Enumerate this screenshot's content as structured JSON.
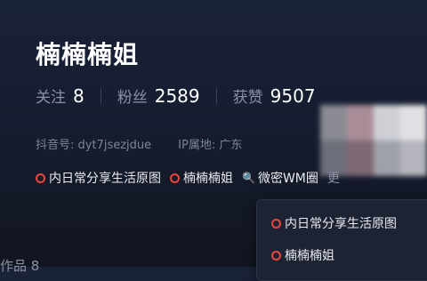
{
  "profile": {
    "name": "楠楠楠姐",
    "stats": [
      {
        "label": "关注",
        "value": "8"
      },
      {
        "label": "粉丝",
        "value": "2589"
      },
      {
        "label": "获赞",
        "value": "9507"
      }
    ],
    "douyin_id": "抖音号: dyt7jsezjdue",
    "ip": "IP属地: 广东"
  },
  "tags": [
    {
      "label": "内日常分享生活原图",
      "icon": "red-ring-icon"
    },
    {
      "label": "楠楠楠姐",
      "icon": "red-ring-icon"
    },
    {
      "label": "微密WM圈",
      "icon": "magnifier-icon"
    },
    {
      "label": "更"
    }
  ],
  "dropdown": {
    "items": [
      {
        "label": "内日常分享生活原图",
        "icon": "red-ring-icon"
      },
      {
        "label": "楠楠楠姐",
        "icon": "red-ring-icon"
      }
    ]
  },
  "partial_row": {
    "text": "作品 8"
  },
  "colors": {
    "accent_red": "#e8473f",
    "background": "#1a2238",
    "muted_text": "#8b92a6"
  }
}
